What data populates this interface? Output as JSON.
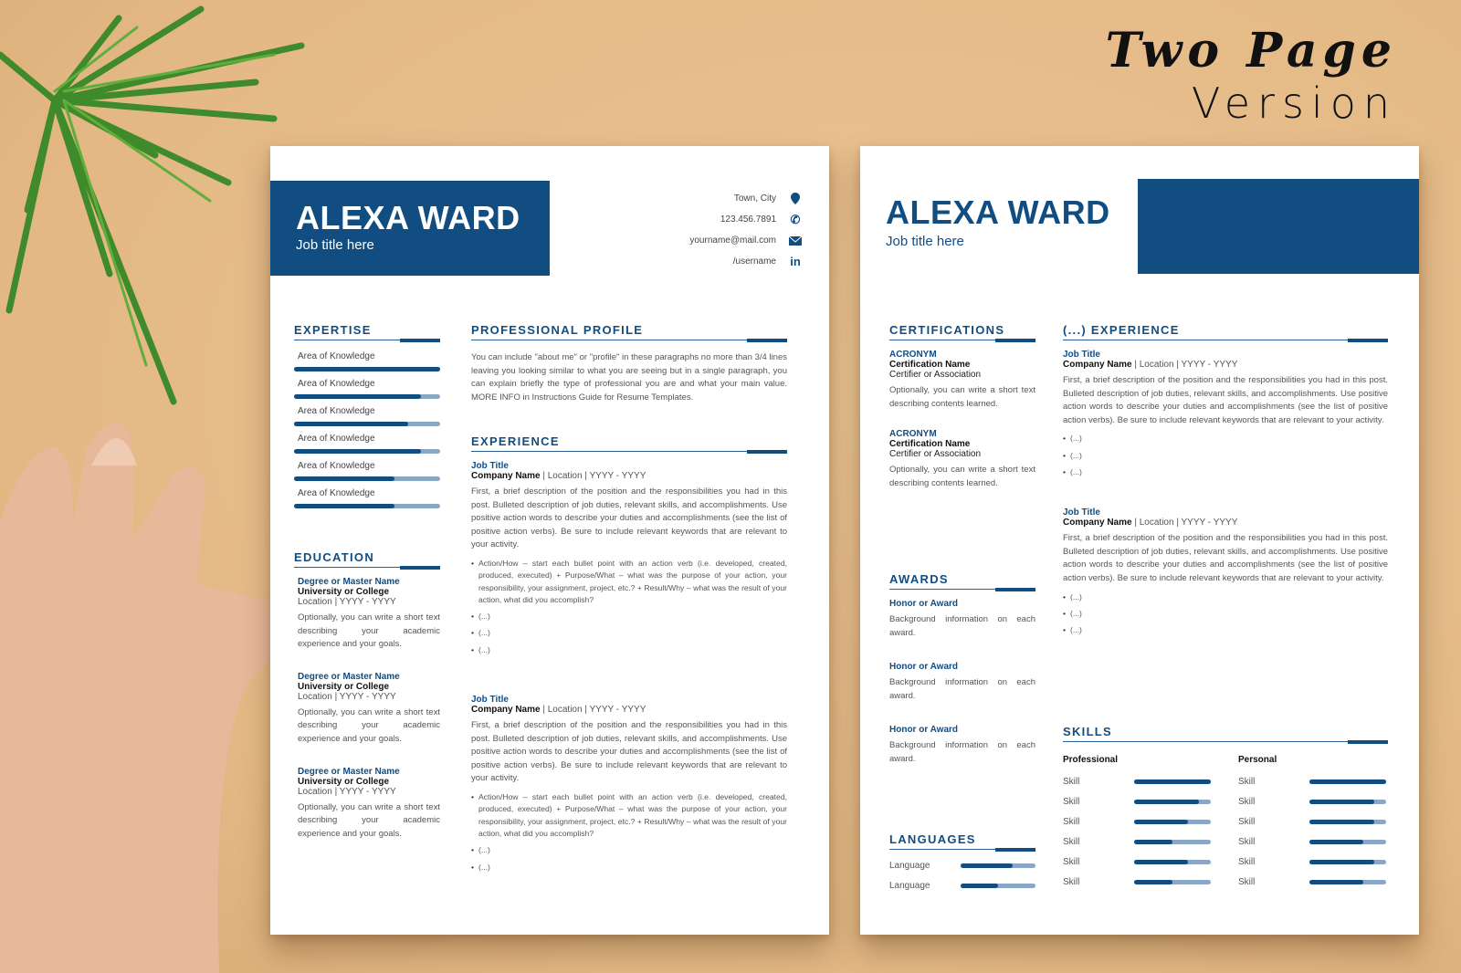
{
  "promo": {
    "line1": "Two Page",
    "line2": "Version"
  },
  "page1": {
    "name": "ALEXA WARD",
    "job_title": "Job title here",
    "contacts": [
      {
        "text": "Town, City",
        "icon": "location-pin-icon"
      },
      {
        "text": "123.456.7891",
        "icon": "phone-icon"
      },
      {
        "text": "yourname@mail.com",
        "icon": "email-icon"
      },
      {
        "text": "/username",
        "icon": "linkedin-icon"
      }
    ],
    "expertise": {
      "title": "EXPERTISE",
      "items": [
        {
          "label": "Area of Knowledge",
          "level": 1.0
        },
        {
          "label": "Area of Knowledge",
          "level": 0.87
        },
        {
          "label": "Area of Knowledge",
          "level": 0.78
        },
        {
          "label": "Area of Knowledge",
          "level": 0.87
        },
        {
          "label": "Area of Knowledge",
          "level": 0.69
        },
        {
          "label": "Area of Knowledge",
          "level": 0.69
        }
      ]
    },
    "education": {
      "title": "EDUCATION",
      "items": [
        {
          "degree": "Degree or Master Name",
          "school": "University or College",
          "meta": "Location | YYYY - YYYY",
          "desc": "Optionally, you can write a short text describing your academic experience and your goals."
        },
        {
          "degree": "Degree or Master Name",
          "school": "University or College",
          "meta": "Location | YYYY - YYYY",
          "desc": "Optionally, you can write a short text describing your academic experience and your goals."
        },
        {
          "degree": "Degree or Master Name",
          "school": "University or College",
          "meta": "Location | YYYY - YYYY",
          "desc": "Optionally, you can write a short text describing your academic experience and your goals."
        }
      ]
    },
    "profile": {
      "title": "PROFESSIONAL PROFILE",
      "text": "You can include \"about me\" or \"profile\" in these paragraphs no more than 3/4 lines leaving you looking similar to what you are seeing but in a single paragraph, you can explain briefly the type of professional you are and what your main value. MORE INFO in Instructions Guide for Resume Templates."
    },
    "experience": {
      "title": "EXPERIENCE",
      "jobs": [
        {
          "title": "Job Title",
          "company": "Company Name",
          "meta": " | Location | YYYY - YYYY",
          "desc": "First, a brief description of the position and the responsibilities you had in this post. Bulleted description of job duties, relevant skills, and accomplishments. Use positive action words to describe your duties and accomplishments (see the list of positive action verbs). Be sure to include relevant keywords that are relevant to your activity.",
          "bullets": [
            "Action/How – start each bullet point with an action verb (i.e. developed, created, produced, executed) + Purpose/What – what was the purpose of your action, your responsibility, your assignment, project, etc.? + Result/Why – what was the result of your action, what did you accomplish?",
            "(...)",
            "(...)",
            "(...)"
          ]
        },
        {
          "title": "Job Title",
          "company": "Company Name",
          "meta": " | Location | YYYY - YYYY",
          "desc": "First, a brief description of the position and the responsibilities you had in this post. Bulleted description of job duties, relevant skills, and accomplishments. Use positive action words to describe your duties and accomplishments (see the list of positive action verbs). Be sure to include relevant keywords that are relevant to your activity.",
          "bullets": [
            "Action/How – start each bullet point with an action verb (i.e. developed, created, produced, executed) + Purpose/What – what was the purpose of your action, your responsibility, your assignment, project, etc.? + Result/Why – what was the result of your action, what did you accomplish?",
            "(...)",
            "(...)"
          ]
        }
      ]
    }
  },
  "page2": {
    "name": "ALEXA WARD",
    "job_title": "Job title here",
    "certifications": {
      "title": "CERTIFICATIONS",
      "items": [
        {
          "acronym": "ACRONYM",
          "name": "Certification Name",
          "issuer": "Certifier or Association",
          "desc": "Optionally, you can write a short text describing contents learned."
        },
        {
          "acronym": "ACRONYM",
          "name": "Certification Name",
          "issuer": "Certifier or Association",
          "desc": "Optionally, you can write a short text describing contents learned."
        }
      ]
    },
    "awards": {
      "title": "AWARDS",
      "items": [
        {
          "name": "Honor or Award",
          "desc": "Background information on each award."
        },
        {
          "name": "Honor or Award",
          "desc": "Background information on each award."
        },
        {
          "name": "Honor or Award",
          "desc": "Background information on each award."
        }
      ]
    },
    "languages": {
      "title": "LANGUAGES",
      "items": [
        {
          "label": "Language",
          "level": 0.7
        },
        {
          "label": "Language",
          "level": 0.5
        }
      ]
    },
    "experience": {
      "title": "(...) EXPERIENCE",
      "jobs": [
        {
          "title": "Job Title",
          "company": "Company Name",
          "meta": " | Location | YYYY - YYYY",
          "desc": "First, a brief description of the position and the responsibilities you had in this post. Bulleted description of job duties, relevant skills, and accomplishments. Use positive action words to describe your duties and accomplishments (see the list of positive action verbs). Be sure to include relevant keywords that are relevant to your activity.",
          "bullets": [
            "(...)",
            "(...)",
            "(...)"
          ]
        },
        {
          "title": "Job Title",
          "company": "Company Name",
          "meta": " | Location | YYYY - YYYY",
          "desc": "First, a brief description of the position and the responsibilities you had in this post. Bulleted description of job duties, relevant skills, and accomplishments. Use positive action words to describe your duties and accomplishments (see the list of positive action verbs). Be sure to include relevant keywords that are relevant to your activity.",
          "bullets": [
            "(...)",
            "(...)",
            "(...)"
          ]
        }
      ]
    },
    "skills": {
      "title": "SKILLS",
      "professional": {
        "title": "Professional",
        "items": [
          {
            "label": "Skill",
            "level": 1.0
          },
          {
            "label": "Skill",
            "level": 0.84
          },
          {
            "label": "Skill",
            "level": 0.7
          },
          {
            "label": "Skill",
            "level": 0.5
          },
          {
            "label": "Skill",
            "level": 0.7
          },
          {
            "label": "Skill",
            "level": 0.5
          }
        ]
      },
      "personal": {
        "title": "Personal",
        "items": [
          {
            "label": "Skill",
            "level": 1.0
          },
          {
            "label": "Skill",
            "level": 0.84
          },
          {
            "label": "Skill",
            "level": 0.84
          },
          {
            "label": "Skill",
            "level": 0.7
          },
          {
            "label": "Skill",
            "level": 0.84
          },
          {
            "label": "Skill",
            "level": 0.7
          }
        ]
      }
    }
  }
}
